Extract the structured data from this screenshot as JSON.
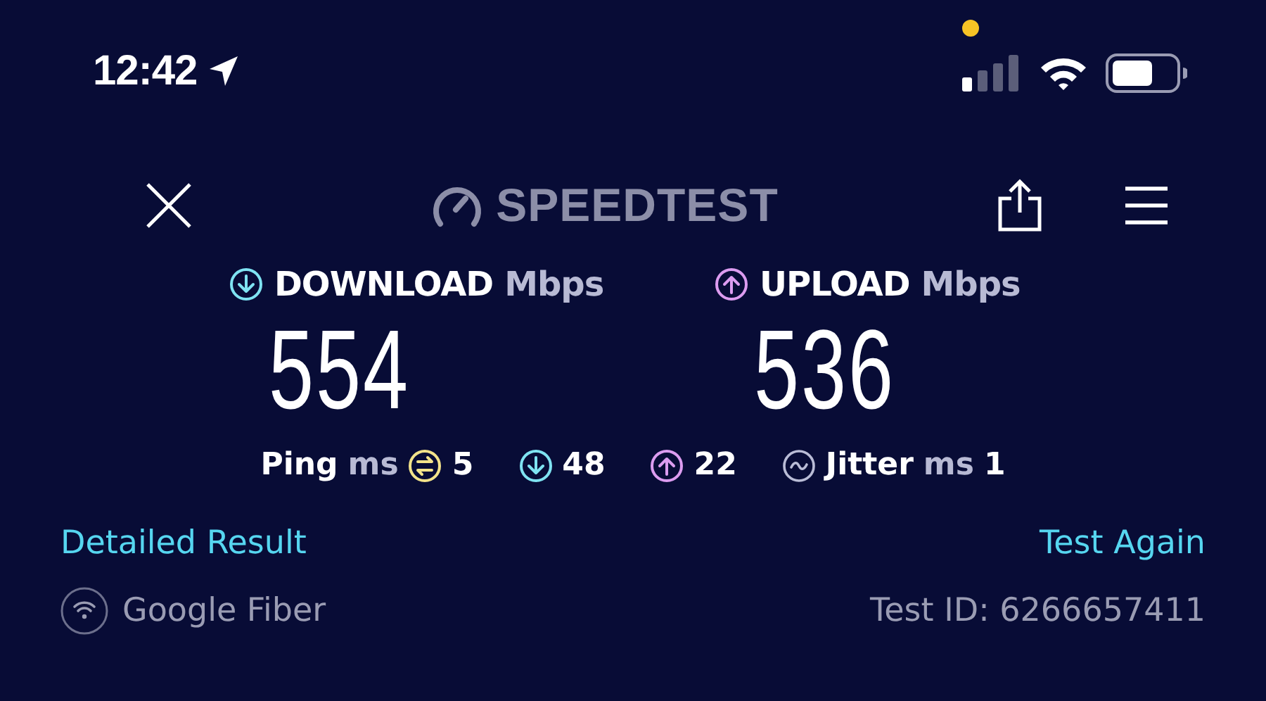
{
  "status_bar": {
    "time": "12:42",
    "location_active": true,
    "recording_dot": true
  },
  "header": {
    "logo": "SPEEDTEST"
  },
  "metrics": [
    {
      "kind": "download",
      "label": "DOWNLOAD",
      "unit": "Mbps",
      "value": "554",
      "color": "#7fe3f2"
    },
    {
      "kind": "upload",
      "label": "UPLOAD",
      "unit": "Mbps",
      "value": "536",
      "color": "#dc9cf0"
    }
  ],
  "latency": [
    {
      "kind": "ping",
      "label": "Ping",
      "unit": "ms",
      "value": "5",
      "color": "#f3e38a"
    },
    {
      "kind": "download",
      "value": "48",
      "color": "#7fe3f2"
    },
    {
      "kind": "upload",
      "value": "22",
      "color": "#dc9cf0"
    },
    {
      "kind": "jitter",
      "label": "Jitter",
      "unit": "ms",
      "value": "1",
      "color": "#b9bcd6"
    }
  ],
  "links": {
    "detailed": "Detailed Result",
    "again": "Test Again"
  },
  "footer": {
    "provider": "Google Fiber",
    "test_id": "Test ID: 6266657411"
  }
}
